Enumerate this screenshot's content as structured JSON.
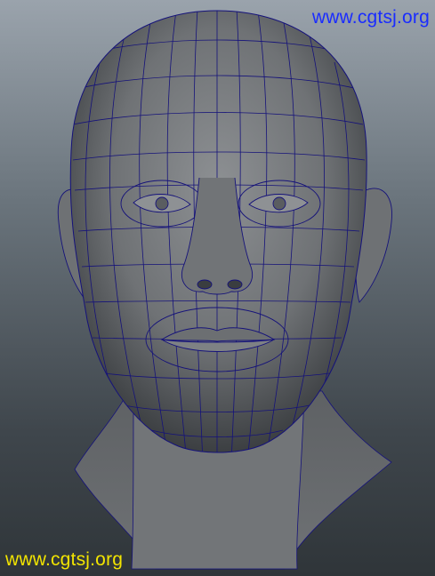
{
  "viewport": {
    "subject": "head-wireframe-model",
    "colors": {
      "background_top": "#9aa3ac",
      "background_bottom": "#2f3539",
      "shading": "#7b7e81",
      "wireframe": "#15127a"
    }
  },
  "watermarks": {
    "top_right": {
      "text": "www.cgtsj.org",
      "color": "#1a2cff"
    },
    "bottom_left": {
      "text": "www.cgtsj.org",
      "color": "#f2e400"
    }
  }
}
